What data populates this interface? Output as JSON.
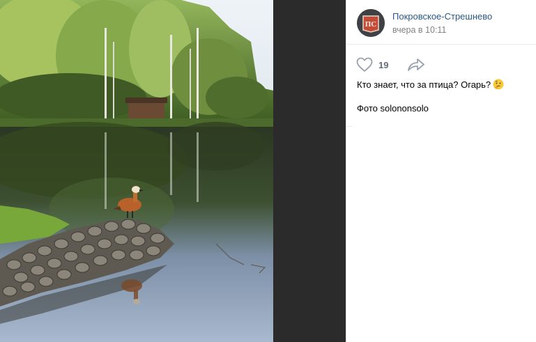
{
  "post": {
    "author_name": "Покровское-Стрешнево",
    "avatar_text": "ПС",
    "time": "вчера в 10:11",
    "likes": "19",
    "text_line1": "Кто знает, что за птица? Огарь?",
    "text_line2": "Фото solononsolo"
  },
  "icons": {
    "like": "heart-outline-icon",
    "share": "share-arrow-icon",
    "emoji": "thinking-face-emoji-icon"
  },
  "colors": {
    "link": "#2a5885",
    "meta": "#828282",
    "divider": "#e7e8ec",
    "gap_bg": "#2b2b2b",
    "icon_gray": "#99a2ad"
  }
}
